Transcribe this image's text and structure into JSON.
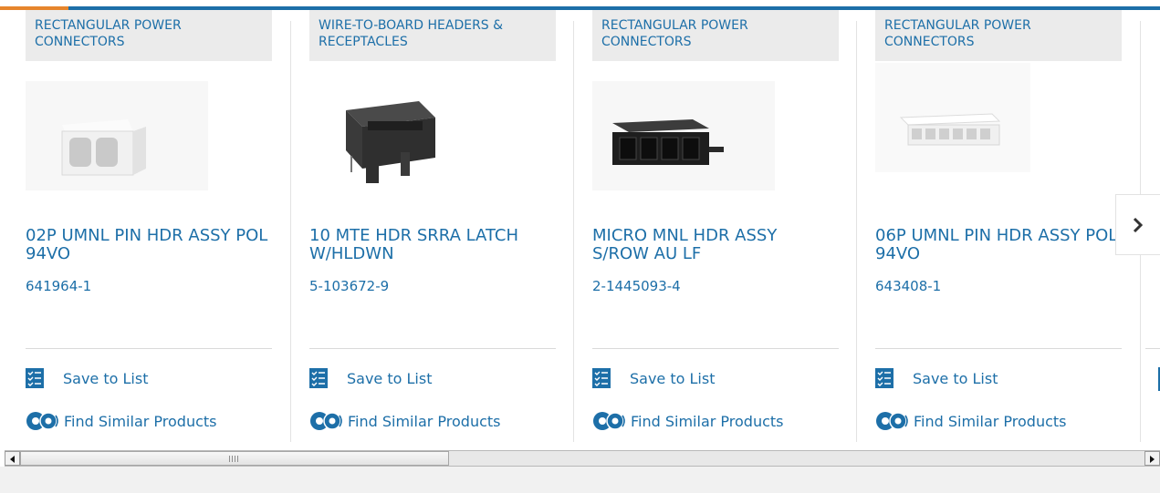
{
  "products": [
    {
      "category": "RECTANGULAR POWER CONNECTORS",
      "title": "02P UMNL PIN HDR ASSY POL 94VO",
      "part_number": "641964-1",
      "image_icon": "white-2-pin-header-connector",
      "save_label": "Save to List",
      "similar_label": "Find Similar Products"
    },
    {
      "category": "WIRE-TO-BOARD HEADERS & RECEPTACLES",
      "title": "10 MTE HDR SRRA LATCH W/HLDWN",
      "part_number": "5-103672-9",
      "image_icon": "black-latch-header-connector",
      "save_label": "Save to List",
      "similar_label": "Find Similar Products"
    },
    {
      "category": "RECTANGULAR POWER CONNECTORS",
      "title": "MICRO MNL HDR ASSY S/ROW AU LF",
      "part_number": "2-1445093-4",
      "image_icon": "black-4-pin-header-connector",
      "save_label": "Save to List",
      "similar_label": "Find Similar Products"
    },
    {
      "category": "RECTANGULAR POWER CONNECTORS",
      "title": "06P UMNL PIN HDR ASSY POL 94VO",
      "part_number": "643408-1",
      "image_icon": "white-6-pin-header-connector",
      "save_label": "Save to List",
      "similar_label": "Find Similar Products"
    }
  ],
  "controls": {
    "next_icon": "chevron-right-icon",
    "scroll_left_icon": "scroll-left-arrow-icon",
    "scroll_right_icon": "scroll-right-arrow-icon"
  },
  "colors": {
    "accent": "#1d6fa8",
    "top_highlight": "#e6852c",
    "category_bg": "#ebebeb"
  }
}
